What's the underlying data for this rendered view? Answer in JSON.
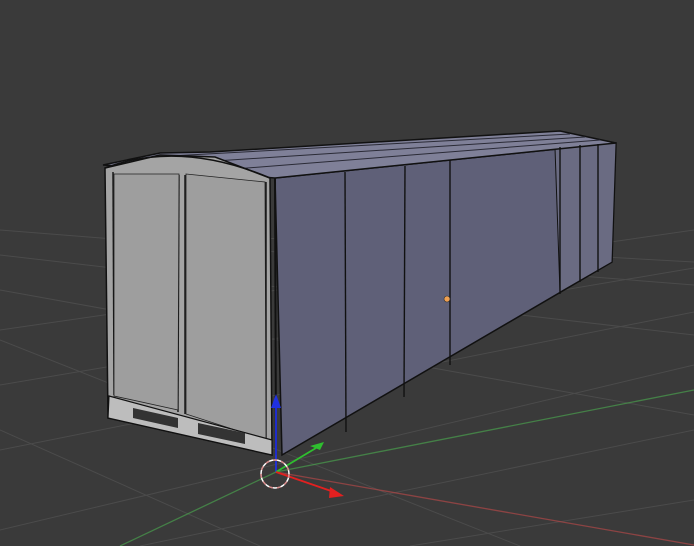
{
  "viewport": {
    "background": "#3a3a3a",
    "grid_color": "#4a4a4a",
    "x_axis_color": "#b04848",
    "y_axis_color": "#4caf50"
  },
  "model": {
    "object_name": "container",
    "face_light_color": "#a4a4a4",
    "face_side_color": "#5f6078",
    "roof_color": "#7f8098",
    "edge_color": "#111111",
    "origin_color": "#f0a050"
  },
  "gizmo": {
    "x_axis_color": "#e22020",
    "y_axis_color": "#2fbf2f",
    "z_axis_color": "#2030e0",
    "cursor_color": "#ffffff"
  }
}
